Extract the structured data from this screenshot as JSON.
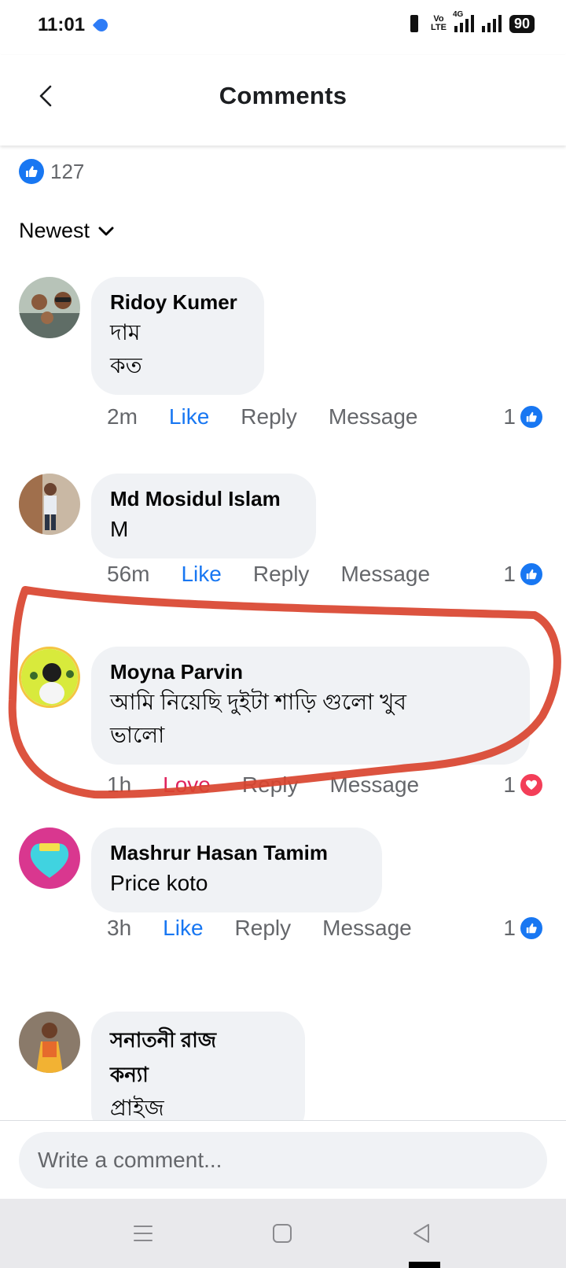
{
  "status_bar": {
    "time": "11:01",
    "volte": "Vo",
    "lte": "LTE",
    "network": "4G",
    "battery": "90"
  },
  "header": {
    "title": "Comments"
  },
  "reactions": {
    "icon": "like-icon",
    "count": "127"
  },
  "sort": {
    "label": "Newest"
  },
  "comments": [
    {
      "author": "Ridoy Kumer",
      "lines": [
        "দাম",
        "কত"
      ],
      "time": "2m",
      "like_label": "Like",
      "reply_label": "Reply",
      "message_label": "Message",
      "reaction_count": "1",
      "reaction_type": "like"
    },
    {
      "author": "Md Mosidul Islam",
      "lines": [
        "M"
      ],
      "time": "56m",
      "like_label": "Like",
      "reply_label": "Reply",
      "message_label": "Message",
      "reaction_count": "1",
      "reaction_type": "like"
    },
    {
      "author": "Moyna Parvin",
      "lines": [
        "আমি নিয়েছি দুইটা শাড়ি গুলো খুব",
        "ভালো"
      ],
      "time": "1h",
      "like_label": "Love",
      "reply_label": "Reply",
      "message_label": "Message",
      "reaction_count": "1",
      "reaction_type": "love"
    },
    {
      "author": "Mashrur Hasan Tamim",
      "lines": [
        "Price koto"
      ],
      "time": "3h",
      "like_label": "Like",
      "reply_label": "Reply",
      "message_label": "Message",
      "reaction_count": "1",
      "reaction_type": "like"
    },
    {
      "author_lines": [
        "সনাতনী রাজ",
        "কন্যা"
      ],
      "lines": [
        "প্রাইজ"
      ]
    }
  ],
  "composer": {
    "placeholder": "Write a comment..."
  },
  "colors": {
    "accent": "#1877f2",
    "love": "#e0245e",
    "highlight": "#d9442f",
    "bubble": "#f0f2f5"
  }
}
